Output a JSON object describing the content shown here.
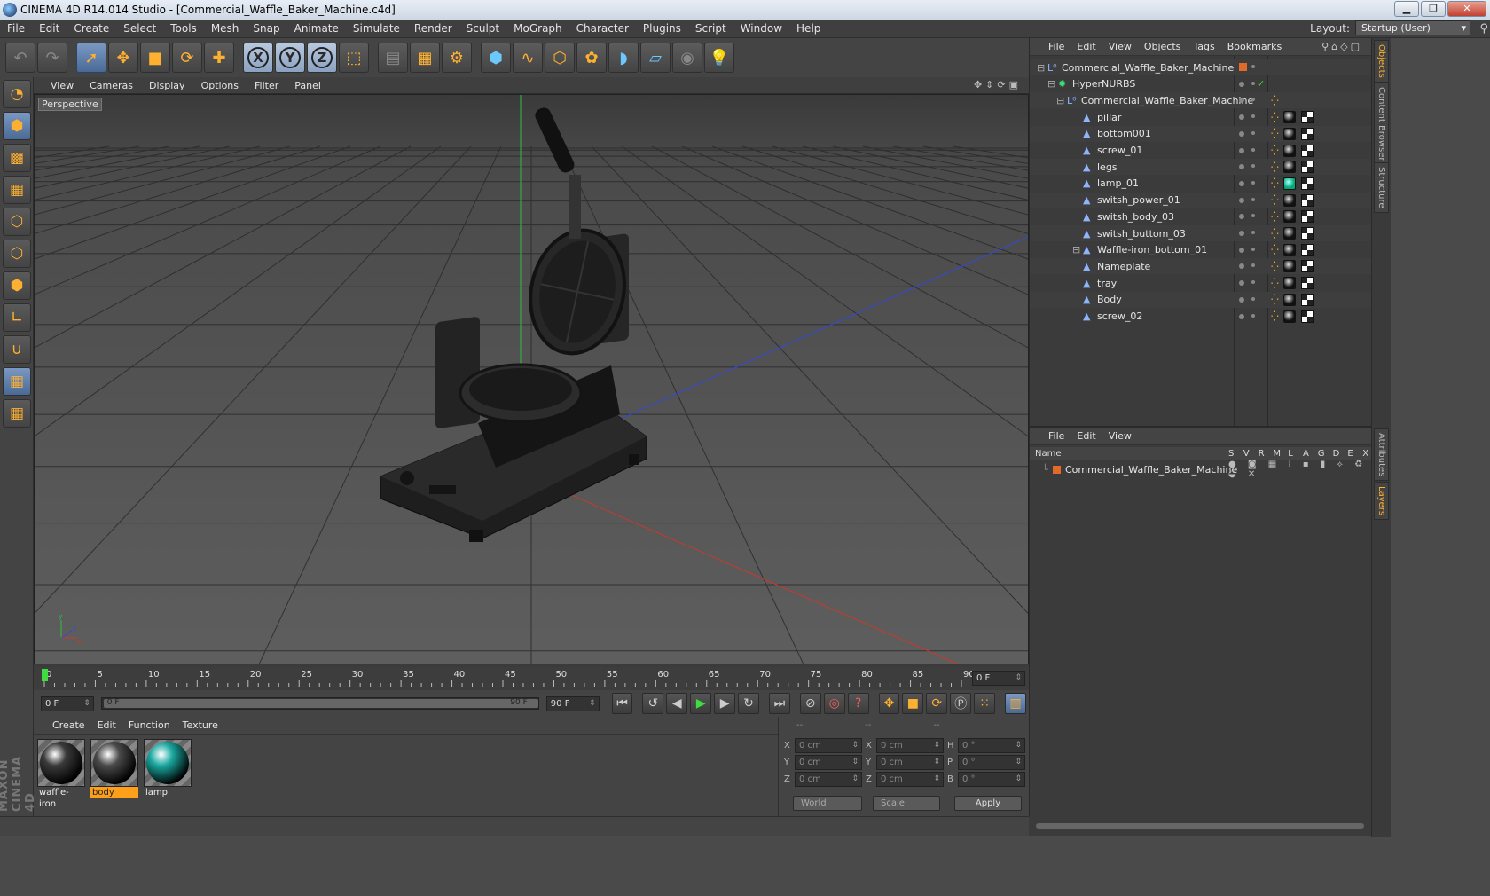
{
  "window": {
    "title": "CINEMA 4D R14.014 Studio - [Commercial_Waffle_Baker_Machine.c4d]"
  },
  "menu": [
    "File",
    "Edit",
    "Create",
    "Select",
    "Tools",
    "Mesh",
    "Snap",
    "Animate",
    "Simulate",
    "Render",
    "Sculpt",
    "MoGraph",
    "Character",
    "Plugins",
    "Script",
    "Window",
    "Help"
  ],
  "layout": {
    "label": "Layout:",
    "value": "Startup (User)"
  },
  "viewport": {
    "menu": [
      "View",
      "Cameras",
      "Display",
      "Options",
      "Filter",
      "Panel"
    ],
    "label": "Perspective"
  },
  "timeline": {
    "ticks": [
      "0",
      "5",
      "10",
      "15",
      "20",
      "25",
      "30",
      "35",
      "40",
      "45",
      "50",
      "55",
      "60",
      "65",
      "70",
      "75",
      "80",
      "85",
      "90"
    ],
    "current_frame_right": "0 F",
    "start": "0 F",
    "range_left": "0 F",
    "range_right": "90 F",
    "end": "90 F"
  },
  "materials": {
    "menu": [
      "Create",
      "Edit",
      "Function",
      "Texture"
    ],
    "items": [
      {
        "name": "waffle-iron",
        "selected": false,
        "color": "#3a3a3a"
      },
      {
        "name": "body",
        "selected": true,
        "color": "#4a4a4a"
      },
      {
        "name": "lamp",
        "selected": false,
        "color": "#1aa8a0"
      }
    ]
  },
  "coordinates": {
    "headers": [
      "--",
      "--",
      "--"
    ],
    "rows": [
      {
        "a": "X",
        "v1": "0 cm",
        "b": "X",
        "v2": "0 cm",
        "c": "H",
        "v3": "0 °"
      },
      {
        "a": "Y",
        "v1": "0 cm",
        "b": "Y",
        "v2": "0 cm",
        "c": "P",
        "v3": "0 °"
      },
      {
        "a": "Z",
        "v1": "0 cm",
        "b": "Z",
        "v2": "0 cm",
        "c": "B",
        "v3": "0 °"
      }
    ],
    "mode1": "World",
    "mode2": "Scale",
    "apply": "Apply"
  },
  "objects_panel": {
    "menu": [
      "File",
      "Edit",
      "View",
      "Objects",
      "Tags",
      "Bookmarks"
    ],
    "items": [
      {
        "name": "Commercial_Waffle_Baker_Machine",
        "level": 0,
        "type": "null"
      },
      {
        "name": "HyperNURBS",
        "level": 1,
        "type": "nurbs"
      },
      {
        "name": "Commercial_Waffle_Baker_Machine",
        "level": 2,
        "type": "null"
      },
      {
        "name": "pillar",
        "level": 3,
        "type": "poly"
      },
      {
        "name": "bottom001",
        "level": 3,
        "type": "poly"
      },
      {
        "name": "screw_01",
        "level": 3,
        "type": "poly"
      },
      {
        "name": "legs",
        "level": 3,
        "type": "poly"
      },
      {
        "name": "lamp_01",
        "level": 3,
        "type": "poly"
      },
      {
        "name": "switsh_power_01",
        "level": 3,
        "type": "poly"
      },
      {
        "name": "switsh_body_03",
        "level": 3,
        "type": "poly"
      },
      {
        "name": "switsh_buttom_03",
        "level": 3,
        "type": "poly"
      },
      {
        "name": "Waffle-iron_bottom_01",
        "level": 3,
        "type": "poly"
      },
      {
        "name": "Nameplate",
        "level": 3,
        "type": "poly"
      },
      {
        "name": "tray",
        "level": 3,
        "type": "poly"
      },
      {
        "name": "Body",
        "level": 3,
        "type": "poly"
      },
      {
        "name": "screw_02",
        "level": 3,
        "type": "poly"
      }
    ]
  },
  "layers_panel": {
    "menu": [
      "File",
      "Edit",
      "View"
    ],
    "columns": [
      "Name",
      "S",
      "V",
      "R",
      "M",
      "L",
      "A",
      "G",
      "D",
      "E",
      "X"
    ],
    "layer": "Commercial_Waffle_Baker_Machine"
  },
  "side_tabs": [
    "Objects",
    "Content Browser",
    "Structure",
    "Attributes",
    "Layers"
  ],
  "colors": {
    "accent": "#ff9f1a",
    "selection": "#5a7aa8"
  }
}
